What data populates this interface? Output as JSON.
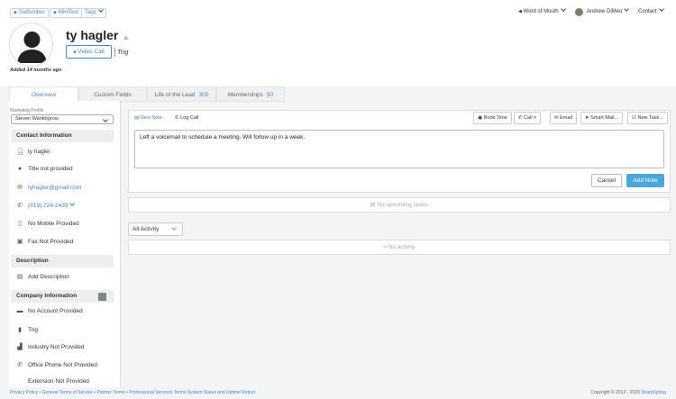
{
  "topbar": {
    "chips": [
      {
        "label": "Subscriber",
        "icon": "tag-icon"
      },
      {
        "label": "MiniTest",
        "icon": "tag-icon"
      },
      {
        "label": "Tags"
      }
    ],
    "word_of_mouth": "Word of Mouth",
    "user_name": "Andrew DiMeo",
    "contact_menu": "Contact"
  },
  "profile": {
    "name": "ty hagler",
    "video_call": "Video Call",
    "company": "Trig",
    "added": "Added 14 months ago"
  },
  "tabs": [
    {
      "label": "Overview"
    },
    {
      "label": "Custom Fields"
    },
    {
      "label": "Life of the Lead",
      "count": "300"
    },
    {
      "label": "Memberships",
      "count": "50"
    }
  ],
  "left": {
    "marketing_profile_label": "Marketing Profile",
    "marketing_profile_value": "Steven Wanttogrow",
    "contact_info_header": "Contact Information",
    "contact_rows": [
      "ty hagler",
      "Title not provided",
      "tyhagler@gmail.com",
      "(919) 724-2439",
      "No Mobile Provided",
      "Fax Not Provided"
    ],
    "description_header": "Description",
    "add_description": "Add Description",
    "company_header": "Company Information",
    "company_rows": [
      "No Account Provided",
      "Trig",
      "Industry Not Provided",
      "Office Phone Not Provided",
      "Extension Not Provided"
    ]
  },
  "main": {
    "new_note": "New Note",
    "log_call": "Log Call",
    "book_time": "Book Time",
    "call": "Call",
    "email": "Email",
    "smart_mail": "Smart Mail...",
    "new_task": "New Task...",
    "note_text": "Left a voicemail to schedule a meeting. Will follow up in a week.",
    "cancel": "Cancel",
    "add_note": "Add Note",
    "no_tasks": "No upcoming tasks.",
    "all_activity": "All Activity",
    "no_activity": "No activity"
  },
  "footer": {
    "links": "Privacy Policy • General Terms of Service • Partner Terms • Professional Services Terms System Status and Uptime Report",
    "copyright": "Copyright © 2012 - 2020 ",
    "brand": "SharpSpring"
  },
  "colors": {
    "accent": "#4a86bf",
    "button": "#4aa8d8"
  }
}
